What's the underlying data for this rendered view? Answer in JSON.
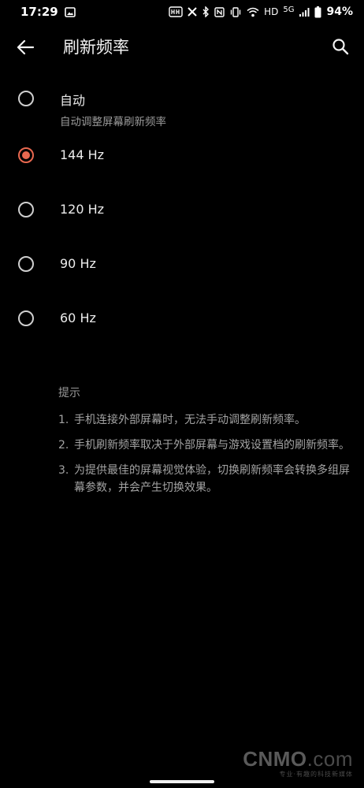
{
  "status_bar": {
    "time": "17:29",
    "network_label": "HD",
    "network_type": "5G",
    "battery": "94%",
    "icons": [
      "image-icon",
      "hz-icon",
      "x-icon",
      "bluetooth-icon",
      "nfc-icon",
      "vibrate-icon",
      "wifi-icon",
      "signal-icon",
      "battery-icon"
    ]
  },
  "app_bar": {
    "title": "刷新频率"
  },
  "options": [
    {
      "label": "自动",
      "sublabel": "自动调整屏幕刷新频率",
      "selected": false
    },
    {
      "label": "144 Hz",
      "selected": true
    },
    {
      "label": "120 Hz",
      "selected": false
    },
    {
      "label": "90 Hz",
      "selected": false
    },
    {
      "label": "60 Hz",
      "selected": false
    }
  ],
  "tips": {
    "title": "提示",
    "items": [
      {
        "num": "1.",
        "text": "手机连接外部屏幕时，无法手动调整刷新频率。"
      },
      {
        "num": "2.",
        "text": "手机刷新频率取决于外部屏幕与游戏设置档的刷新频率。"
      },
      {
        "num": "3.",
        "text": "为提供最佳的屏幕视觉体验，切换刷新频率会转换多组屏幕参数，并会产生切换效果。"
      }
    ]
  },
  "watermark": {
    "logo": "CNMO",
    "logo_suffix": ".com",
    "tagline": "专业·有趣的科技新媒体"
  },
  "colors": {
    "accent": "#e8684f",
    "background": "#000000"
  }
}
